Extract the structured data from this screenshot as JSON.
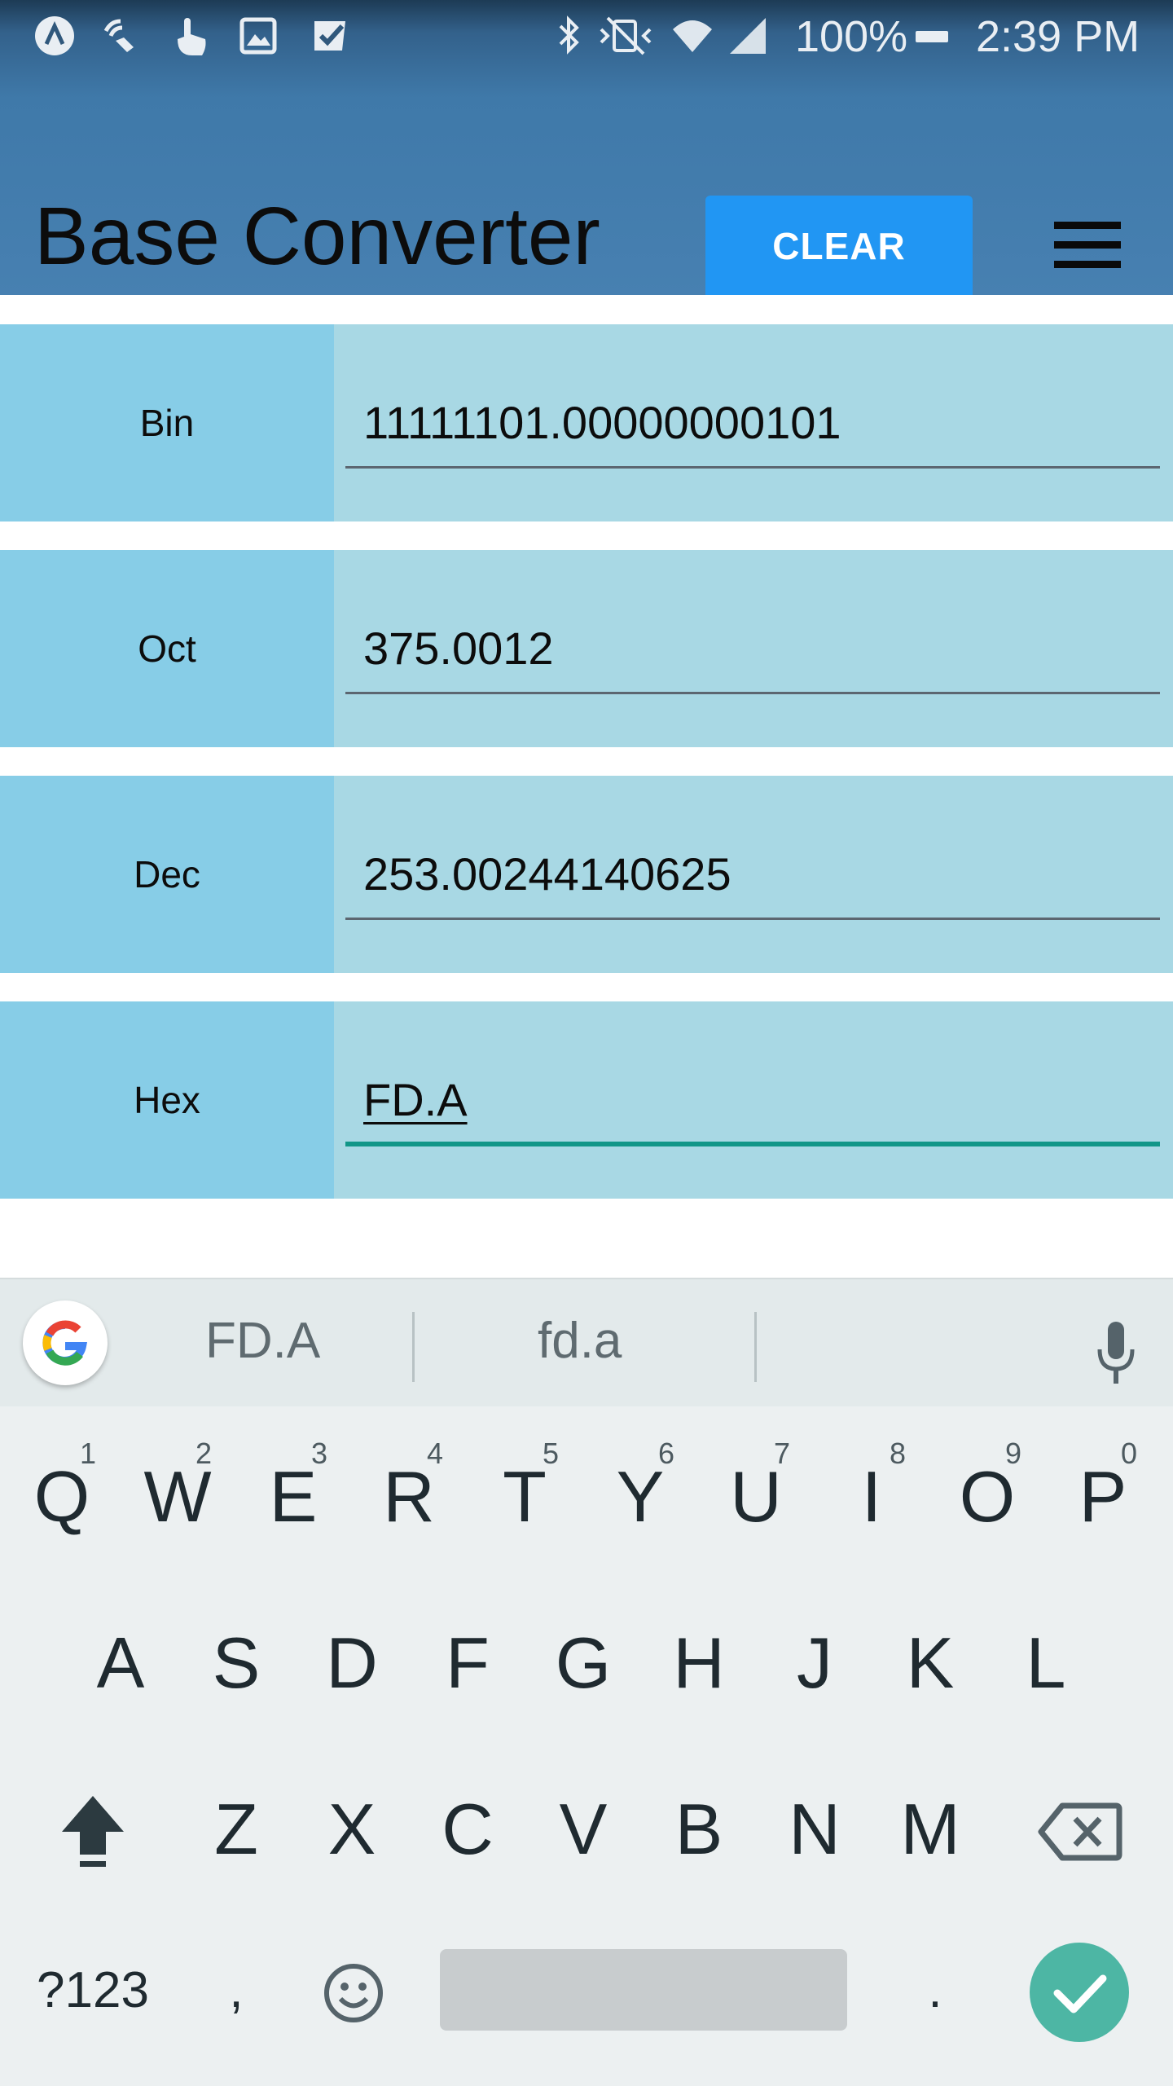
{
  "status_bar": {
    "battery": "100%",
    "time": "2:39 PM"
  },
  "app_bar": {
    "title": "Base Converter",
    "clear_label": "CLEAR"
  },
  "rows": [
    {
      "label": "Bin",
      "value": "11111101.00000000101"
    },
    {
      "label": "Oct",
      "value": "375.0012"
    },
    {
      "label": "Dec",
      "value": "253.00244140625"
    },
    {
      "label": "Hex",
      "value": "FD.A"
    }
  ],
  "keyboard": {
    "suggestions": [
      "FD.A",
      "fd.a"
    ],
    "row1": [
      {
        "key": "Q",
        "hint": "1"
      },
      {
        "key": "W",
        "hint": "2"
      },
      {
        "key": "E",
        "hint": "3"
      },
      {
        "key": "R",
        "hint": "4"
      },
      {
        "key": "T",
        "hint": "5"
      },
      {
        "key": "Y",
        "hint": "6"
      },
      {
        "key": "U",
        "hint": "7"
      },
      {
        "key": "I",
        "hint": "8"
      },
      {
        "key": "O",
        "hint": "9"
      },
      {
        "key": "P",
        "hint": "0"
      }
    ],
    "row2": [
      "A",
      "S",
      "D",
      "F",
      "G",
      "H",
      "J",
      "K",
      "L"
    ],
    "row3": [
      "Z",
      "X",
      "C",
      "V",
      "B",
      "N",
      "M"
    ],
    "symbols_label": "?123",
    "comma_label": ",",
    "period_label": ".",
    "icons": [
      "google-icon",
      "mic-icon",
      "shift-icon",
      "backspace-icon",
      "emoji-icon",
      "checkmark-icon"
    ]
  },
  "colors": {
    "app_bar": "#4780b1",
    "clear_button": "#2196f3",
    "label_cell": "#87cde7",
    "input_cell": "#a8d8e4",
    "focus_underline": "#119688",
    "enter_key": "#4db6a4"
  }
}
